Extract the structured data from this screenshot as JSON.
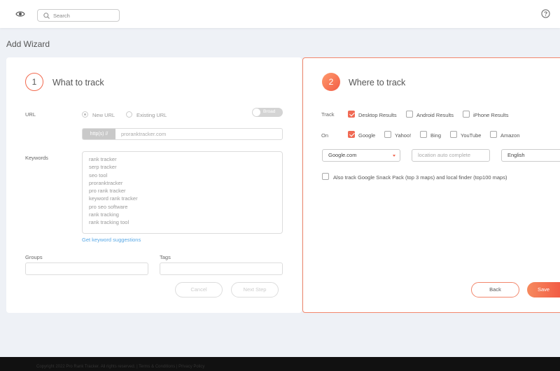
{
  "header": {
    "search_placeholder": "Search"
  },
  "page_title": "Add Wizard",
  "step1": {
    "number": "1",
    "title": "What to track",
    "url_label": "URL",
    "radio_new": "New URL",
    "radio_existing": "Existing URL",
    "toggle_label": "Broad",
    "url_prefix": "http(s) //",
    "url_value": "proranktracker.com",
    "keywords_label": "Keywords",
    "keywords": [
      "rank tracker",
      "serp tracker",
      "seo tool",
      "proranktracker",
      "pro rank tracker",
      "keyword rank tracker",
      "pro seo software",
      "rank tracking",
      "rank tracking tool"
    ],
    "suggestions_link": "Get keyword suggestions",
    "groups_label": "Groups",
    "tags_label": "Tags",
    "cancel_label": "Cancel",
    "next_label": "Next Step"
  },
  "step2": {
    "number": "2",
    "title": "Where to track",
    "track_label": "Track",
    "track_options": [
      {
        "label": "Desktop Results",
        "checked": true
      },
      {
        "label": "Android Results",
        "checked": false
      },
      {
        "label": "iPhone Results",
        "checked": false
      }
    ],
    "on_label": "On",
    "engines": [
      {
        "label": "Google",
        "checked": true
      },
      {
        "label": "Yahoo!",
        "checked": false
      },
      {
        "label": "Bing",
        "checked": false
      },
      {
        "label": "YouTube",
        "checked": false
      },
      {
        "label": "Amazon",
        "checked": false
      }
    ],
    "domain_value": "Google.com",
    "location_placeholder": "location auto complete",
    "language_value": "English",
    "snack_pack_label": "Also track Google Snack Pack (top 3 maps) and local finder (top100 maps)",
    "back_label": "Back",
    "save_label": "Save"
  },
  "footer": {
    "text": "Copyright 2022 Pro Rank Tracker. All rights reserved. | Terms & Conditions | Privacy Policy"
  },
  "colors": {
    "accent": "#f25c45",
    "link": "#5aa9e6"
  }
}
